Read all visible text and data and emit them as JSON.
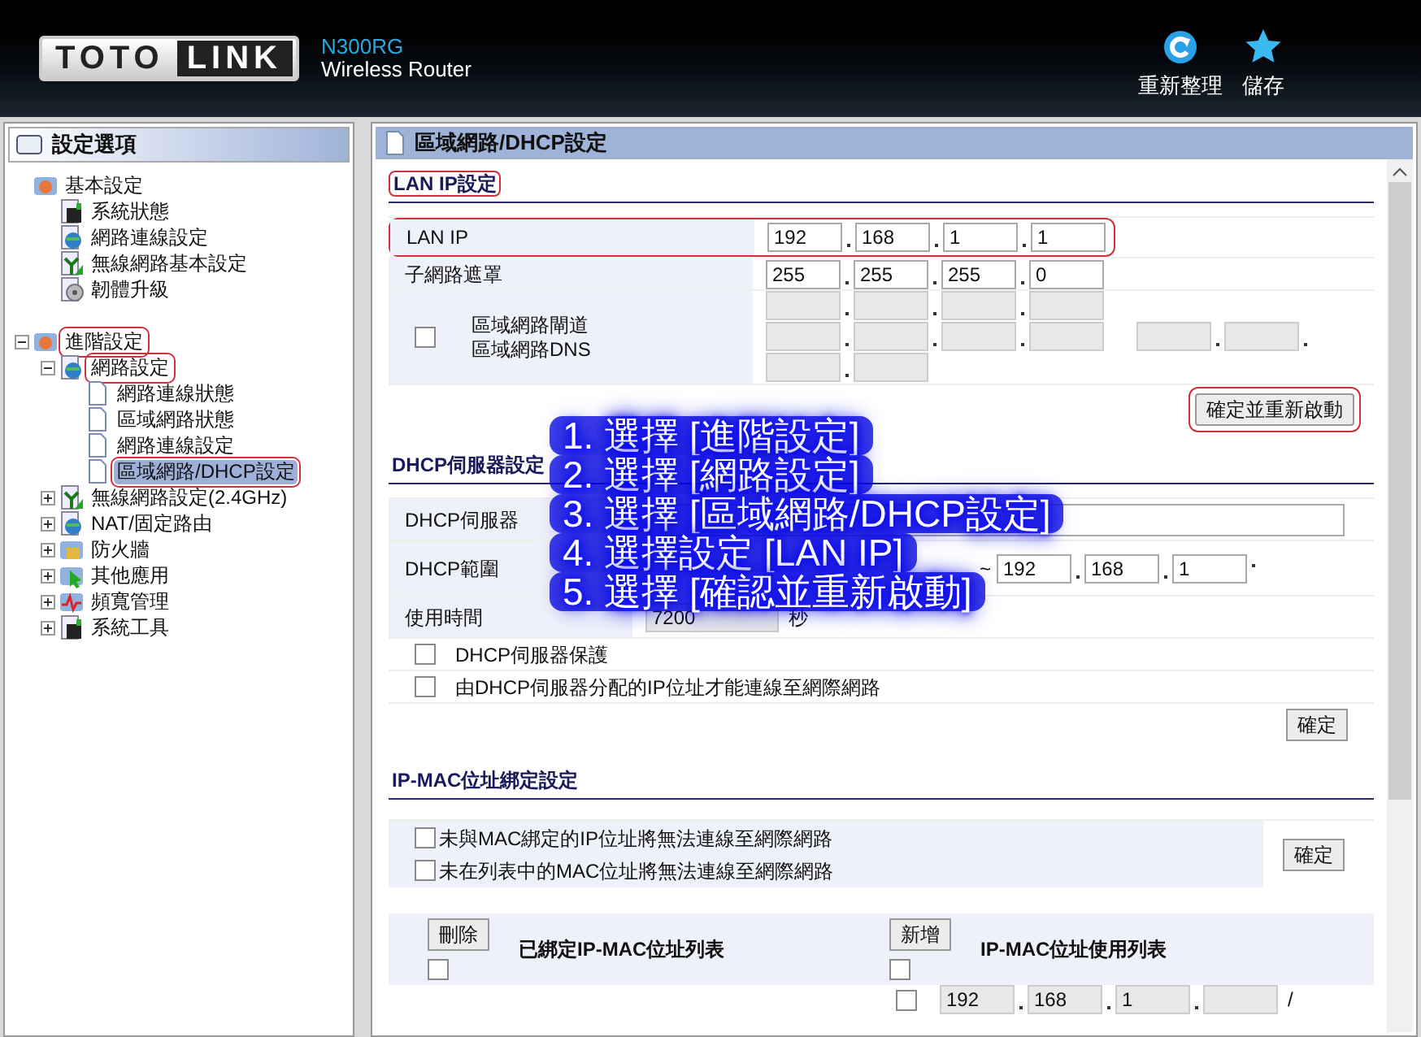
{
  "header": {
    "brand_left": "TOTO",
    "brand_right": "LINK",
    "model": "N300RG",
    "subtitle": "Wireless Router",
    "actions": [
      {
        "kind": "refresh",
        "label": "重新整理"
      },
      {
        "kind": "save",
        "label": "儲存"
      }
    ]
  },
  "sidebar": {
    "title": "設定選項",
    "items": [
      {
        "label": "基本設定",
        "kind": "gear",
        "highlighted": false,
        "selected": false,
        "children": [
          {
            "label": "系統狀態",
            "kind": "monitor",
            "highlighted": false,
            "selected": false
          },
          {
            "label": "網路連線設定",
            "kind": "globe",
            "highlighted": false,
            "selected": false
          },
          {
            "label": "無線網路基本設定",
            "kind": "antenna",
            "highlighted": false,
            "selected": false
          },
          {
            "label": "韌體升級",
            "kind": "disc",
            "highlighted": false,
            "selected": false
          }
        ]
      },
      {
        "label": "進階設定",
        "kind": "gear",
        "expanded": true,
        "highlighted": true,
        "selected": false,
        "children": [
          {
            "label": "網路設定",
            "kind": "globe",
            "expanded": true,
            "highlighted": true,
            "selected": false,
            "children": [
              {
                "label": "網路連線狀態",
                "kind": "page",
                "highlighted": false,
                "selected": false
              },
              {
                "label": "區域網路狀態",
                "kind": "page",
                "highlighted": false,
                "selected": false
              },
              {
                "label": "網路連線設定",
                "kind": "page",
                "highlighted": false,
                "selected": false
              },
              {
                "label": "區域網路/DHCP設定",
                "kind": "page",
                "highlighted": true,
                "selected": true
              }
            ]
          },
          {
            "label": "無線網路設定(2.4GHz)",
            "kind": "antenna",
            "expanded": false,
            "highlighted": false,
            "selected": false
          },
          {
            "label": "NAT/固定路由",
            "kind": "globe",
            "expanded": false,
            "highlighted": false,
            "selected": false
          },
          {
            "label": "防火牆",
            "kind": "lock",
            "expanded": false,
            "highlighted": false,
            "selected": false
          },
          {
            "label": "其他應用",
            "kind": "cursor",
            "expanded": false,
            "highlighted": false,
            "selected": false
          },
          {
            "label": "頻寬管理",
            "kind": "pulse",
            "expanded": false,
            "highlighted": false,
            "selected": false
          },
          {
            "label": "系統工具",
            "kind": "monitor",
            "expanded": false,
            "highlighted": false,
            "selected": false
          }
        ]
      }
    ]
  },
  "content": {
    "title": "區域網路/DHCP設定",
    "lan": {
      "heading": "LAN IP設定",
      "heading_highlighted": true,
      "lan_ip": {
        "label": "LAN IP",
        "octets": [
          "192",
          "168",
          "1",
          "1"
        ],
        "highlighted": true
      },
      "subnet": {
        "label": "子網路遮罩",
        "octets": [
          "255",
          "255",
          "255",
          "0"
        ]
      },
      "gateway_label": "區域網路閘道",
      "dns_label": "區域網路DNS",
      "gateway_checked": false,
      "apply": {
        "label": "確定並重新啟動",
        "highlighted": true
      }
    },
    "dhcp": {
      "heading": "DHCP伺服器設定",
      "server_label": "DHCP伺服器",
      "range_label": "DHCP範圍",
      "range_sep": "~",
      "range_end": [
        "192",
        "168",
        "1"
      ],
      "lease_label": "使用時間",
      "lease_value": "7200",
      "lease_unit": "秒",
      "options": [
        {
          "label": "DHCP伺服器保護",
          "checked": false
        },
        {
          "label": "由DHCP伺服器分配的IP位址才能連線至網際網路",
          "checked": false
        }
      ],
      "apply": "確定"
    },
    "ipmac": {
      "heading": "IP-MAC位址綁定設定",
      "options": [
        {
          "label": "未與MAC綁定的IP位址將無法連線至網際網路",
          "checked": false
        },
        {
          "label": "未在列表中的MAC位址將無法連線至網際網路",
          "checked": false
        }
      ],
      "apply": "確定",
      "bound": {
        "button": "刪除",
        "title": "已綁定IP-MAC位址列表",
        "checked": false
      },
      "usage": {
        "button": "新增",
        "title": "IP-MAC位址使用列表",
        "checked": false,
        "row": {
          "checked": false,
          "octets": [
            "192",
            "168",
            "1"
          ],
          "sep": "/"
        }
      }
    }
  },
  "overlay": [
    "1. 選擇 [進階設定]",
    "2. 選擇 [網路設定]",
    "3. 選擇 [區域網路/DHCP設定]",
    "4. 選擇設定 [LAN IP]",
    "5. 選擇 [確認並重新啟動]"
  ]
}
